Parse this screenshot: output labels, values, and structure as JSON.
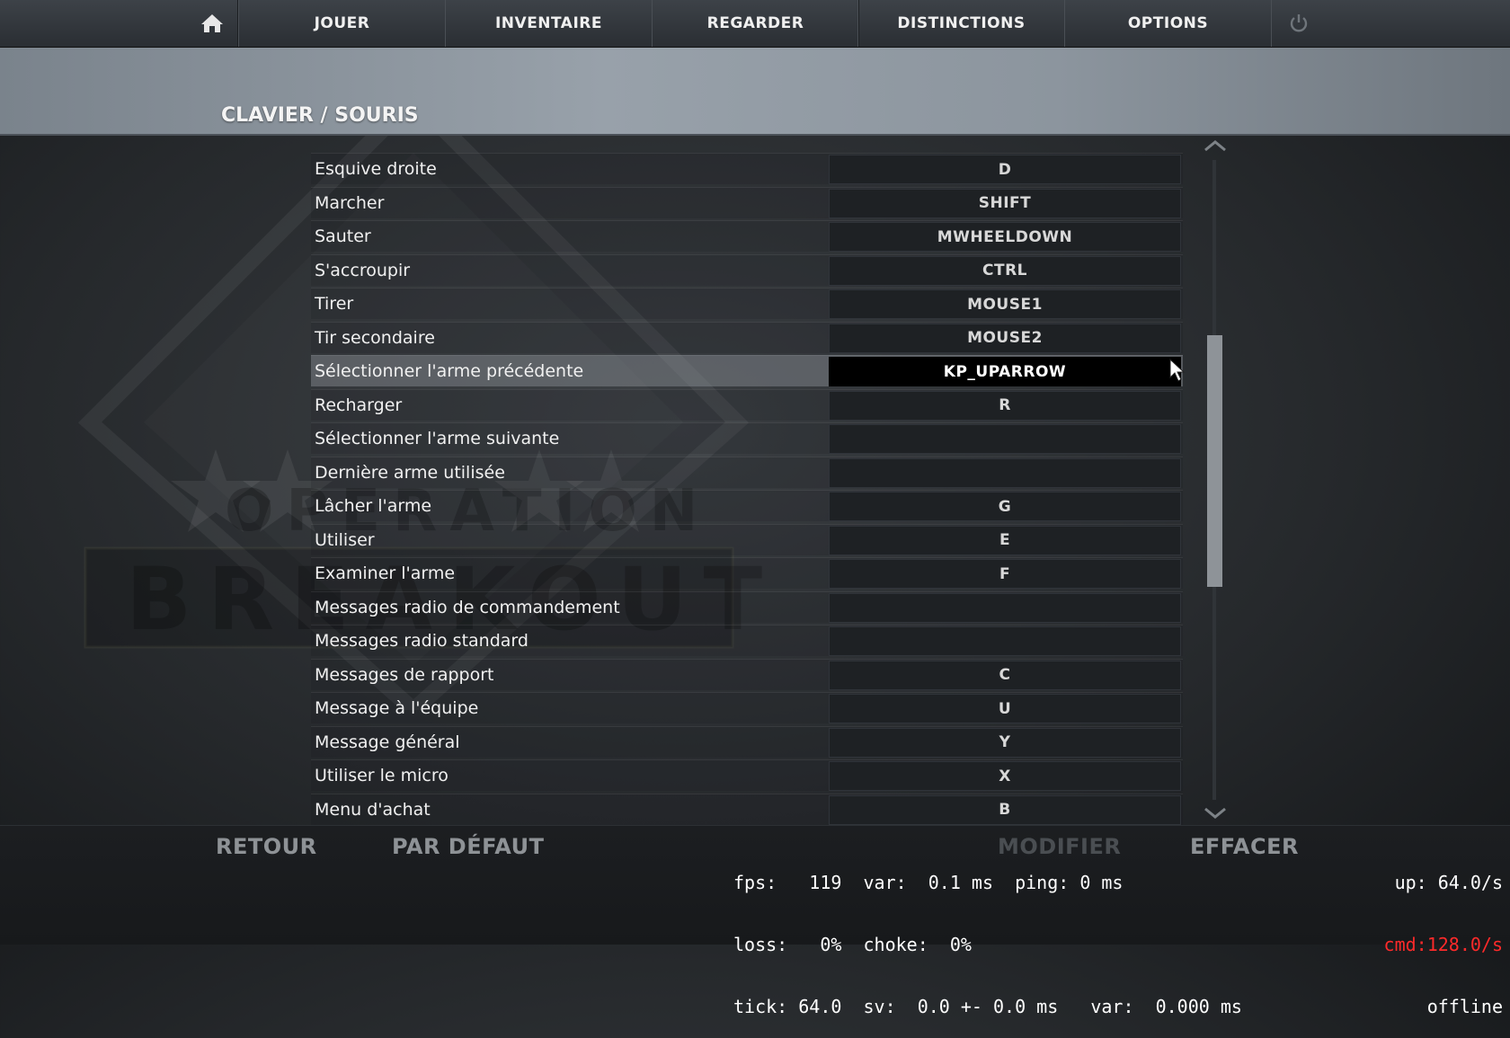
{
  "nav": {
    "home_icon": "home-icon",
    "items": [
      "JOUER",
      "INVENTAIRE",
      "REGARDER",
      "DISTINCTIONS",
      "OPTIONS"
    ],
    "power_icon": "power-icon"
  },
  "page": {
    "title": "CLAVIER / SOURIS"
  },
  "binds": [
    {
      "action": "Esquive droite",
      "key": "D"
    },
    {
      "action": "Marcher",
      "key": "SHIFT"
    },
    {
      "action": "Sauter",
      "key": "MWHEELDOWN"
    },
    {
      "action": "S'accroupir",
      "key": "CTRL"
    },
    {
      "action": "Tirer",
      "key": "MOUSE1"
    },
    {
      "action": "Tir secondaire",
      "key": "MOUSE2"
    },
    {
      "action": "Sélectionner l'arme précédente",
      "key": "KP_UPARROW"
    },
    {
      "action": "Recharger",
      "key": "R"
    },
    {
      "action": "Sélectionner l'arme suivante",
      "key": ""
    },
    {
      "action": "Dernière arme utilisée",
      "key": ""
    },
    {
      "action": "Lâcher l'arme",
      "key": "G"
    },
    {
      "action": "Utiliser",
      "key": "E"
    },
    {
      "action": "Examiner l'arme",
      "key": "F"
    },
    {
      "action": "Messages radio de commandement",
      "key": ""
    },
    {
      "action": "Messages radio standard",
      "key": ""
    },
    {
      "action": "Messages de rapport",
      "key": "C"
    },
    {
      "action": "Message à l'équipe",
      "key": "U"
    },
    {
      "action": "Message général",
      "key": "Y"
    },
    {
      "action": "Utiliser le micro",
      "key": "X"
    },
    {
      "action": "Menu d'achat",
      "key": "B"
    }
  ],
  "selected_index": 6,
  "scrollbar": {
    "position_fraction": 0.27,
    "visible_fraction": 0.39
  },
  "bottom": {
    "back": "RETOUR",
    "defaults": "PAR DÉFAUT",
    "modify": "MODIFIER",
    "clear": "EFFACER"
  },
  "netgraph": {
    "line1": "fps:   119  var:  0.1 ms  ping: 0 ms",
    "line2": "loss:   0%  choke:  0%",
    "line3": "tick: 64.0  sv:  0.0 +- 0.0 ms   var:  0.000 ms",
    "up": "up: 64.0/s",
    "cmd": "cmd:128.0/s",
    "status": "offline",
    "cmd_color": "#ff2a2a"
  },
  "background": {
    "watermark_line1": "OPERATION",
    "watermark_line2": "BREAKOUT"
  }
}
